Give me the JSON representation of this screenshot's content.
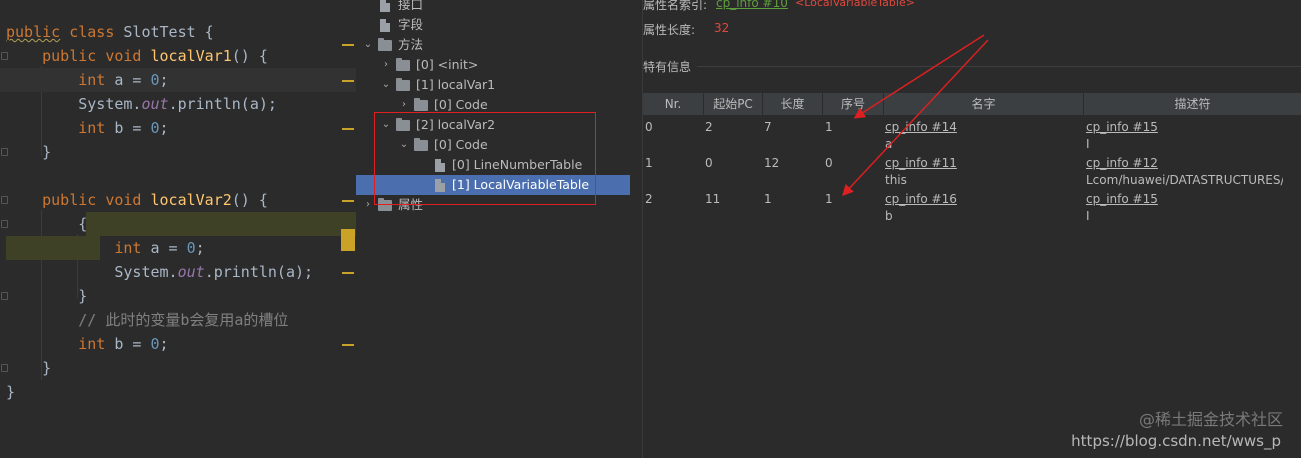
{
  "code": {
    "line1": {
      "kw1": "public",
      "kw2": "class",
      "name": "SlotTest {"
    },
    "line2": {
      "kw1": "public",
      "kw2": "void",
      "fn": "localVar1",
      "rest": "() {"
    },
    "line3": {
      "kw": "int",
      "rest1": " a = ",
      "num": "0",
      "rest2": ";"
    },
    "line4": {
      "pre": "System.",
      "field": "out",
      "post": ".println(a);"
    },
    "line5": {
      "kw": "int",
      "rest1": " b = ",
      "num": "0",
      "rest2": ";"
    },
    "line6": "}",
    "line8": {
      "kw1": "public",
      "kw2": "void",
      "fn": "localVar2",
      "rest": "() {"
    },
    "line9": "{",
    "line10": {
      "kw": "int",
      "rest1": " a = ",
      "num": "0",
      "rest2": ";"
    },
    "line11": {
      "pre": "System.",
      "field": "out",
      "post": ".println(a);"
    },
    "line12": "}",
    "line13": "// 此时的变量b会复用a的槽位",
    "line14": {
      "kw": "int",
      "rest1": " b = ",
      "num": "0",
      "rest2": ";"
    },
    "line15": "}",
    "line16": "}"
  },
  "tree": {
    "interfaces": "接口",
    "fields": "字段",
    "methods": "方法",
    "init": "[0] <init>",
    "localVar1": "[1] localVar1",
    "code1": "[0] Code",
    "localVar2": "[2] localVar2",
    "code2": "[0] Code",
    "lnt": "[0] LineNumberTable",
    "lvt": "[1] LocalVariableTable",
    "attributes": "属性"
  },
  "info": {
    "name_index_label": "属性名索引:",
    "name_index_link": "cp_info #10",
    "name_index_value": "<LocalVariableTable>",
    "length_label": "属性长度:",
    "length_value": "32",
    "section_title": "特有信息",
    "columns": [
      "Nr.",
      "起始PC",
      "长度",
      "序号",
      "名字",
      "描述符"
    ],
    "rows": [
      {
        "nr": "0",
        "start": "2",
        "len": "7",
        "idx": "1",
        "name_link": "cp_info #14",
        "name": "a",
        "desc_link": "cp_info #15",
        "desc": "I"
      },
      {
        "nr": "1",
        "start": "0",
        "len": "12",
        "idx": "0",
        "name_link": "cp_info #11",
        "name": "this",
        "desc_link": "cp_info #12",
        "desc": "Lcom/huawei/DATASTRUCTURES/s"
      },
      {
        "nr": "2",
        "start": "11",
        "len": "1",
        "idx": "1",
        "name_link": "cp_info #16",
        "name": "b",
        "desc_link": "cp_info #15",
        "desc": "I"
      }
    ]
  },
  "watermark": {
    "site": "@稀土掘金技术社区",
    "url": "https://blog.csdn.net/wws_p"
  },
  "colors": {
    "keyword": "#cc7832",
    "number": "#6897bb",
    "link": "#5e9e3e",
    "red": "#e0483e",
    "selection": "#4b6eaf"
  }
}
